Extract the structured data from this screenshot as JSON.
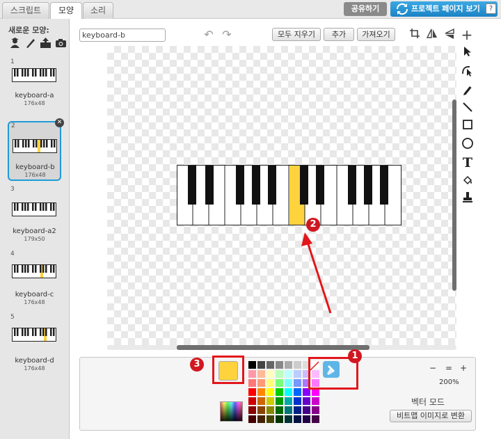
{
  "tabs": [
    {
      "label": "스크립트"
    },
    {
      "label": "모양"
    },
    {
      "label": "소리"
    }
  ],
  "header": {
    "share_label": "공유하기",
    "project_page_label": "프로젝트 페이지 보기",
    "help_label": "?"
  },
  "sidebar": {
    "new_costume_label": "새로운 모양:",
    "costumes": [
      {
        "num": "1",
        "name": "keyboard-a",
        "size": "176x48"
      },
      {
        "num": "2",
        "name": "keyboard-b",
        "size": "176x48"
      },
      {
        "num": "3",
        "name": "keyboard-a2",
        "size": "179x50"
      },
      {
        "num": "4",
        "name": "keyboard-c",
        "size": "176x48"
      },
      {
        "num": "5",
        "name": "keyboard-d",
        "size": "176x48"
      }
    ]
  },
  "toolbar": {
    "costume_name": "keyboard-b",
    "clear_label": "모두 지우기",
    "add_label": "추가",
    "import_label": "가져오기"
  },
  "bottom": {
    "zoom_level": "200%",
    "mode_label": "벡터 모드",
    "convert_label": "비트맵 이미지로 변환",
    "zoom_out": "−",
    "zoom_reset": "=",
    "zoom_in": "+"
  },
  "annotations": {
    "m1": "1",
    "m2": "2",
    "m3": "3"
  },
  "colors": {
    "fill_color": "#ffd33d",
    "annotation_red": "#e2161b",
    "accent_blue": "#1f9ad8"
  }
}
